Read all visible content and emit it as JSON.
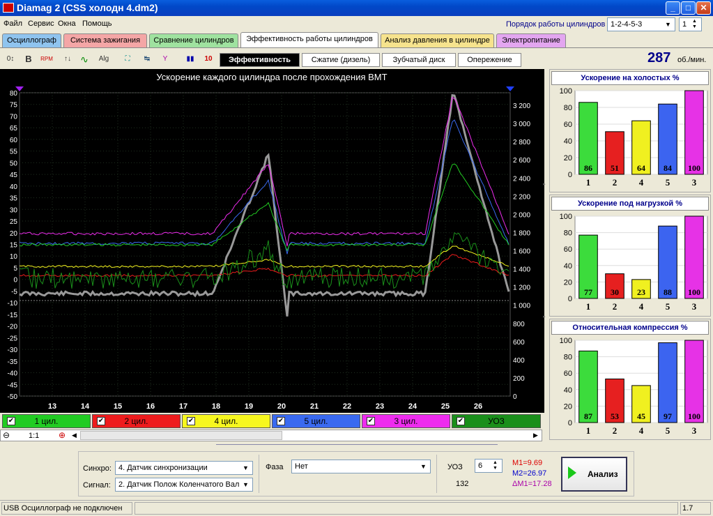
{
  "window": {
    "title": "Diamag 2 (CSS холодн 4.dm2)",
    "min": "_",
    "max": "□",
    "close": "✕"
  },
  "menu": [
    "Файл",
    "Сервис",
    "Окна",
    "Помощь"
  ],
  "firing_order": {
    "label": "Порядок работы цилиндров",
    "value": "1-2-4-5-3",
    "spin": "1"
  },
  "tabs": [
    {
      "label": "Осциллограф",
      "color": "#8fc4ef"
    },
    {
      "label": "Система зажигания",
      "color": "#f4a6a6"
    },
    {
      "label": "Сравнение цилиндров",
      "color": "#9fe29f"
    },
    {
      "label": "Эффективность работы цилиндров",
      "color": "#ffffff"
    },
    {
      "label": "Анализ давления в цилиндре",
      "color": "#f6e38d"
    },
    {
      "label": "Электропитание",
      "color": "#e3a6f0"
    }
  ],
  "toolbar": [
    "0↕",
    "B",
    "RPM",
    "↑↓",
    "∿",
    "Alg",
    "⛶",
    "↹",
    "Y",
    "▮▮",
    "10"
  ],
  "subtabs": [
    "Эффективность",
    "Сжатие (дизель)",
    "Зубчатый диск",
    "Опережение"
  ],
  "rpm": {
    "value": "287",
    "unit": "об./мин."
  },
  "chart": {
    "title": "Ускорение каждого цилиндра после прохождения ВМТ",
    "left_ticks": [
      "80",
      "75",
      "70",
      "65",
      "60",
      "55",
      "50",
      "45",
      "40",
      "35",
      "30",
      "25",
      "20",
      "15",
      "10",
      "5",
      "0",
      "-5",
      "-10",
      "-15",
      "-20",
      "-25",
      "-30",
      "-35",
      "-40",
      "-45",
      "-50"
    ],
    "right_ticks": [
      "3 200",
      "3 000",
      "2 800",
      "2 600",
      "2 400",
      "2 200",
      "2 000",
      "1 800",
      "1 600",
      "1 400",
      "1 200",
      "1 000",
      "800",
      "600",
      "400",
      "200",
      "0"
    ],
    "x_ticks": [
      "13",
      "14",
      "15",
      "16",
      "17",
      "18",
      "19",
      "20",
      "21",
      "22",
      "23",
      "24",
      "25",
      "26"
    ]
  },
  "chart_data": [
    {
      "type": "bar",
      "title": "Ускорение на холостых %",
      "categories": [
        "1",
        "2",
        "4",
        "5",
        "3"
      ],
      "values": [
        86,
        51,
        64,
        84,
        100
      ],
      "ylim": [
        0,
        100
      ],
      "colors": [
        "#3cdc3c",
        "#e62020",
        "#f0f020",
        "#3c64f0",
        "#e632e6"
      ]
    },
    {
      "type": "bar",
      "title": "Ускорение под нагрузкой %",
      "categories": [
        "1",
        "2",
        "4",
        "5",
        "3"
      ],
      "values": [
        77,
        30,
        23,
        88,
        100
      ],
      "ylim": [
        0,
        100
      ],
      "colors": [
        "#3cdc3c",
        "#e62020",
        "#f0f020",
        "#3c64f0",
        "#e632e6"
      ]
    },
    {
      "type": "bar",
      "title": "Относительная компрессия %",
      "categories": [
        "1",
        "2",
        "4",
        "5",
        "3"
      ],
      "values": [
        87,
        53,
        45,
        97,
        100
      ],
      "ylim": [
        0,
        100
      ],
      "colors": [
        "#3cdc3c",
        "#e62020",
        "#f0f020",
        "#3c64f0",
        "#e632e6"
      ]
    }
  ],
  "legend": [
    {
      "label": "1 цил.",
      "color": "#22cc22",
      "check": "✔"
    },
    {
      "label": "2 цил.",
      "color": "#ee1c1c",
      "check": "✔"
    },
    {
      "label": "4 цил.",
      "color": "#f7f71e",
      "check": "✔"
    },
    {
      "label": "5 цил.",
      "color": "#3a6af0",
      "check": "✔"
    },
    {
      "label": "3 цил.",
      "color": "#ee2cee",
      "check": "✔"
    },
    {
      "label": "УОЗ",
      "color": "#1a8f1a",
      "check": "✔"
    }
  ],
  "zoom": {
    "minus": "⊖",
    "value": "1:1",
    "plus": "⊕"
  },
  "controls": {
    "sync_label": "Синхро:",
    "sync_value": "4. Датчик синхронизации",
    "signal_label": "Сигнал:",
    "signal_value": "2. Датчик Полож Коленчатого Вал",
    "phase_label": "Фаза",
    "phase_value": "Нет",
    "uoz_label": "УОЗ",
    "uoz_value": "6",
    "uoz_extra": "132",
    "m1": "M1=9.69",
    "m2": "M2=26.97",
    "dm": "ΔM1=17.28",
    "analyze": "Анализ"
  },
  "status": {
    "left": "USB Осциллограф не подключен",
    "right": "1.7"
  }
}
